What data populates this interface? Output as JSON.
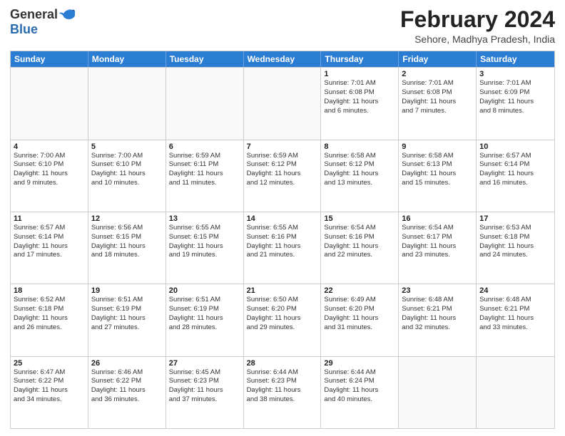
{
  "logo": {
    "general": "General",
    "blue": "Blue"
  },
  "title": "February 2024",
  "location": "Sehore, Madhya Pradesh, India",
  "days": [
    "Sunday",
    "Monday",
    "Tuesday",
    "Wednesday",
    "Thursday",
    "Friday",
    "Saturday"
  ],
  "rows": [
    [
      {
        "day": "",
        "lines": []
      },
      {
        "day": "",
        "lines": []
      },
      {
        "day": "",
        "lines": []
      },
      {
        "day": "",
        "lines": []
      },
      {
        "day": "1",
        "lines": [
          "Sunrise: 7:01 AM",
          "Sunset: 6:08 PM",
          "Daylight: 11 hours",
          "and 6 minutes."
        ]
      },
      {
        "day": "2",
        "lines": [
          "Sunrise: 7:01 AM",
          "Sunset: 6:08 PM",
          "Daylight: 11 hours",
          "and 7 minutes."
        ]
      },
      {
        "day": "3",
        "lines": [
          "Sunrise: 7:01 AM",
          "Sunset: 6:09 PM",
          "Daylight: 11 hours",
          "and 8 minutes."
        ]
      }
    ],
    [
      {
        "day": "4",
        "lines": [
          "Sunrise: 7:00 AM",
          "Sunset: 6:10 PM",
          "Daylight: 11 hours",
          "and 9 minutes."
        ]
      },
      {
        "day": "5",
        "lines": [
          "Sunrise: 7:00 AM",
          "Sunset: 6:10 PM",
          "Daylight: 11 hours",
          "and 10 minutes."
        ]
      },
      {
        "day": "6",
        "lines": [
          "Sunrise: 6:59 AM",
          "Sunset: 6:11 PM",
          "Daylight: 11 hours",
          "and 11 minutes."
        ]
      },
      {
        "day": "7",
        "lines": [
          "Sunrise: 6:59 AM",
          "Sunset: 6:12 PM",
          "Daylight: 11 hours",
          "and 12 minutes."
        ]
      },
      {
        "day": "8",
        "lines": [
          "Sunrise: 6:58 AM",
          "Sunset: 6:12 PM",
          "Daylight: 11 hours",
          "and 13 minutes."
        ]
      },
      {
        "day": "9",
        "lines": [
          "Sunrise: 6:58 AM",
          "Sunset: 6:13 PM",
          "Daylight: 11 hours",
          "and 15 minutes."
        ]
      },
      {
        "day": "10",
        "lines": [
          "Sunrise: 6:57 AM",
          "Sunset: 6:14 PM",
          "Daylight: 11 hours",
          "and 16 minutes."
        ]
      }
    ],
    [
      {
        "day": "11",
        "lines": [
          "Sunrise: 6:57 AM",
          "Sunset: 6:14 PM",
          "Daylight: 11 hours",
          "and 17 minutes."
        ]
      },
      {
        "day": "12",
        "lines": [
          "Sunrise: 6:56 AM",
          "Sunset: 6:15 PM",
          "Daylight: 11 hours",
          "and 18 minutes."
        ]
      },
      {
        "day": "13",
        "lines": [
          "Sunrise: 6:55 AM",
          "Sunset: 6:15 PM",
          "Daylight: 11 hours",
          "and 19 minutes."
        ]
      },
      {
        "day": "14",
        "lines": [
          "Sunrise: 6:55 AM",
          "Sunset: 6:16 PM",
          "Daylight: 11 hours",
          "and 21 minutes."
        ]
      },
      {
        "day": "15",
        "lines": [
          "Sunrise: 6:54 AM",
          "Sunset: 6:16 PM",
          "Daylight: 11 hours",
          "and 22 minutes."
        ]
      },
      {
        "day": "16",
        "lines": [
          "Sunrise: 6:54 AM",
          "Sunset: 6:17 PM",
          "Daylight: 11 hours",
          "and 23 minutes."
        ]
      },
      {
        "day": "17",
        "lines": [
          "Sunrise: 6:53 AM",
          "Sunset: 6:18 PM",
          "Daylight: 11 hours",
          "and 24 minutes."
        ]
      }
    ],
    [
      {
        "day": "18",
        "lines": [
          "Sunrise: 6:52 AM",
          "Sunset: 6:18 PM",
          "Daylight: 11 hours",
          "and 26 minutes."
        ]
      },
      {
        "day": "19",
        "lines": [
          "Sunrise: 6:51 AM",
          "Sunset: 6:19 PM",
          "Daylight: 11 hours",
          "and 27 minutes."
        ]
      },
      {
        "day": "20",
        "lines": [
          "Sunrise: 6:51 AM",
          "Sunset: 6:19 PM",
          "Daylight: 11 hours",
          "and 28 minutes."
        ]
      },
      {
        "day": "21",
        "lines": [
          "Sunrise: 6:50 AM",
          "Sunset: 6:20 PM",
          "Daylight: 11 hours",
          "and 29 minutes."
        ]
      },
      {
        "day": "22",
        "lines": [
          "Sunrise: 6:49 AM",
          "Sunset: 6:20 PM",
          "Daylight: 11 hours",
          "and 31 minutes."
        ]
      },
      {
        "day": "23",
        "lines": [
          "Sunrise: 6:48 AM",
          "Sunset: 6:21 PM",
          "Daylight: 11 hours",
          "and 32 minutes."
        ]
      },
      {
        "day": "24",
        "lines": [
          "Sunrise: 6:48 AM",
          "Sunset: 6:21 PM",
          "Daylight: 11 hours",
          "and 33 minutes."
        ]
      }
    ],
    [
      {
        "day": "25",
        "lines": [
          "Sunrise: 6:47 AM",
          "Sunset: 6:22 PM",
          "Daylight: 11 hours",
          "and 34 minutes."
        ]
      },
      {
        "day": "26",
        "lines": [
          "Sunrise: 6:46 AM",
          "Sunset: 6:22 PM",
          "Daylight: 11 hours",
          "and 36 minutes."
        ]
      },
      {
        "day": "27",
        "lines": [
          "Sunrise: 6:45 AM",
          "Sunset: 6:23 PM",
          "Daylight: 11 hours",
          "and 37 minutes."
        ]
      },
      {
        "day": "28",
        "lines": [
          "Sunrise: 6:44 AM",
          "Sunset: 6:23 PM",
          "Daylight: 11 hours",
          "and 38 minutes."
        ]
      },
      {
        "day": "29",
        "lines": [
          "Sunrise: 6:44 AM",
          "Sunset: 6:24 PM",
          "Daylight: 11 hours",
          "and 40 minutes."
        ]
      },
      {
        "day": "",
        "lines": []
      },
      {
        "day": "",
        "lines": []
      }
    ]
  ]
}
